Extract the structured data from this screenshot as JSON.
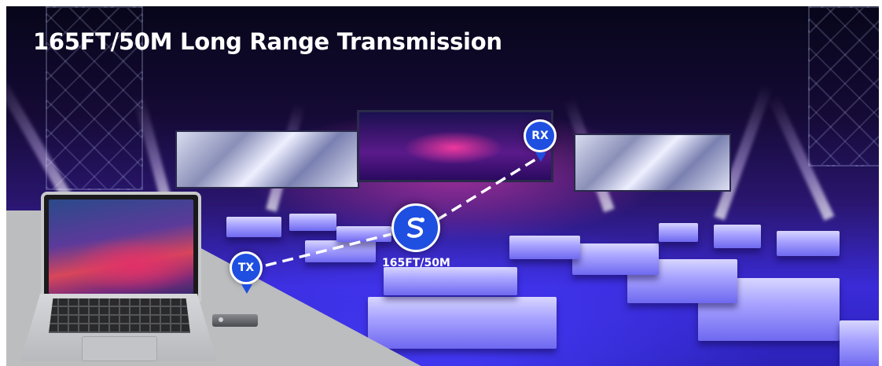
{
  "banner": {
    "title": "165FT/50M Long Range Transmission",
    "tx_label": "TX",
    "rx_label": "RX",
    "distance_label": "165FT/50M",
    "hub_icon": "signal-s-icon"
  },
  "colors": {
    "badge_blue": "#1f4fe0",
    "text_white": "#ffffff",
    "link_line": "#ffffff"
  }
}
